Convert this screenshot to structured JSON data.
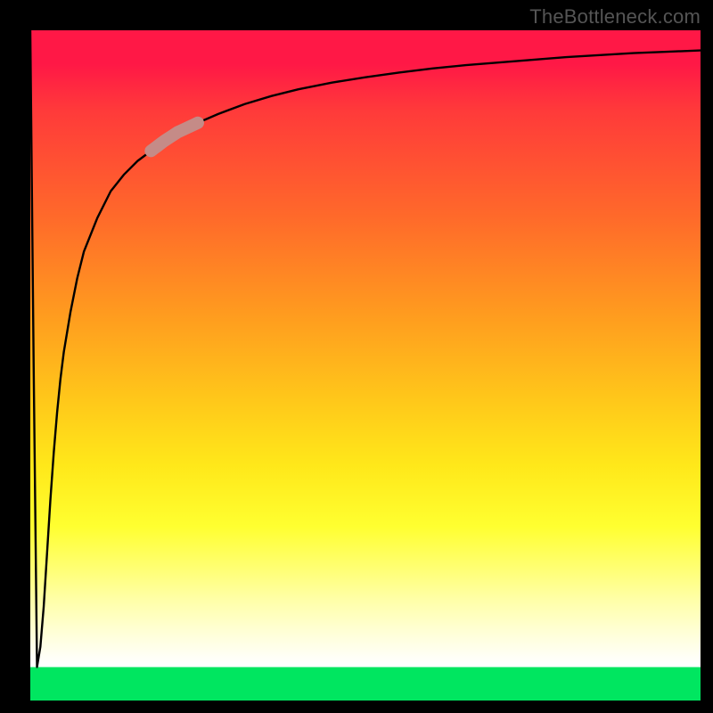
{
  "attribution": "TheBottleneck.com",
  "colors": {
    "frame": "#000000",
    "gradient_top": "#ff1846",
    "gradient_mid": "#ffe81a",
    "gradient_white": "#ffffff",
    "gradient_bottom": "#00e660",
    "curve": "#000000",
    "highlight": "#c58b87"
  },
  "chart_data": {
    "type": "line",
    "title": "",
    "xlabel": "",
    "ylabel": "",
    "xlim": [
      0,
      100
    ],
    "ylim": [
      0,
      100
    ],
    "x": [
      0,
      0.5,
      1,
      1.5,
      2,
      2.5,
      3,
      3.5,
      4,
      4.5,
      5,
      6,
      7,
      8,
      10,
      12,
      14,
      16,
      18,
      20,
      22,
      25,
      28,
      32,
      36,
      40,
      45,
      50,
      55,
      60,
      65,
      70,
      75,
      80,
      85,
      90,
      95,
      100
    ],
    "y": [
      100,
      50,
      5,
      8,
      14,
      22,
      30,
      37,
      43,
      48,
      52,
      58,
      63,
      67,
      72,
      76,
      78.5,
      80.5,
      82,
      83.5,
      84.8,
      86.2,
      87.5,
      89,
      90.2,
      91.2,
      92.2,
      93,
      93.7,
      94.3,
      94.8,
      95.2,
      95.6,
      96,
      96.3,
      96.6,
      96.8,
      97
    ],
    "series": [
      {
        "name": "bottleneck-curve",
        "x": [
          0,
          0.5,
          1,
          1.5,
          2,
          2.5,
          3,
          3.5,
          4,
          4.5,
          5,
          6,
          7,
          8,
          10,
          12,
          14,
          16,
          18,
          20,
          22,
          25,
          28,
          32,
          36,
          40,
          45,
          50,
          55,
          60,
          65,
          70,
          75,
          80,
          85,
          90,
          95,
          100
        ],
        "y": [
          100,
          50,
          5,
          8,
          14,
          22,
          30,
          37,
          43,
          48,
          52,
          58,
          63,
          67,
          72,
          76,
          78.5,
          80.5,
          82,
          83.5,
          84.8,
          86.2,
          87.5,
          89,
          90.2,
          91.2,
          92.2,
          93,
          93.7,
          94.3,
          94.8,
          95.2,
          95.6,
          96,
          96.3,
          96.6,
          96.8,
          97
        ]
      }
    ],
    "highlight_segment": {
      "x_start": 18,
      "x_end": 25,
      "y_start": 82,
      "y_end": 86.2
    },
    "annotations": [
      "TheBottleneck.com"
    ]
  }
}
